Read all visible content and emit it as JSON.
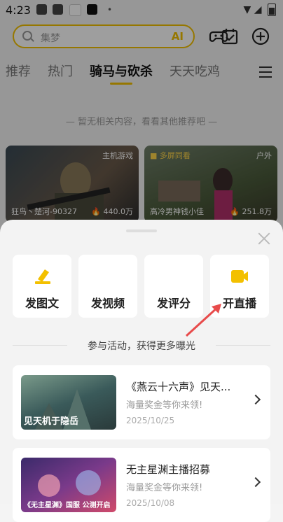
{
  "status_bar": {
    "time": "4:23",
    "dot": "•"
  },
  "search": {
    "placeholder": "集梦",
    "ai_label": "AI"
  },
  "tabs": [
    {
      "label": "推荐"
    },
    {
      "label": "热门"
    },
    {
      "label": "骑马与砍杀"
    },
    {
      "label": "天天吃鸡"
    },
    {
      "label": "!"
    }
  ],
  "empty_notice": "— 暂无相关内容，看看其他推荐吧 —",
  "live_cards": [
    {
      "tag": "主机游戏",
      "name": "狂鸟丶楚河-90327",
      "views": "🔥 440.0万"
    },
    {
      "tag_left": "■ 多屏同看",
      "tag": "户外",
      "name": "高冷男神钱小佳",
      "views": "🔥 251.8万"
    }
  ],
  "sheet": {
    "actions": [
      {
        "label": "发图文"
      },
      {
        "label": "发视频"
      },
      {
        "label": "发评分"
      },
      {
        "label": "开直播"
      }
    ],
    "section_title": "参与活动，获得更多曝光",
    "promos": [
      {
        "title": "《燕云十六声》见天...",
        "desc": "海量奖金等你来领!",
        "date": "2025/10/25",
        "thumb_text": "见天机于隐岳"
      },
      {
        "title": "无主星渊主播招募",
        "desc": "海量奖金等你来领!",
        "date": "2025/10/08",
        "thumb_text": "《无主星渊》国服 公测开启"
      }
    ]
  },
  "colors": {
    "accent": "#f3c000",
    "overlay": "rgba(0,0,0,0.38)",
    "arrow": "#e84b4b"
  }
}
